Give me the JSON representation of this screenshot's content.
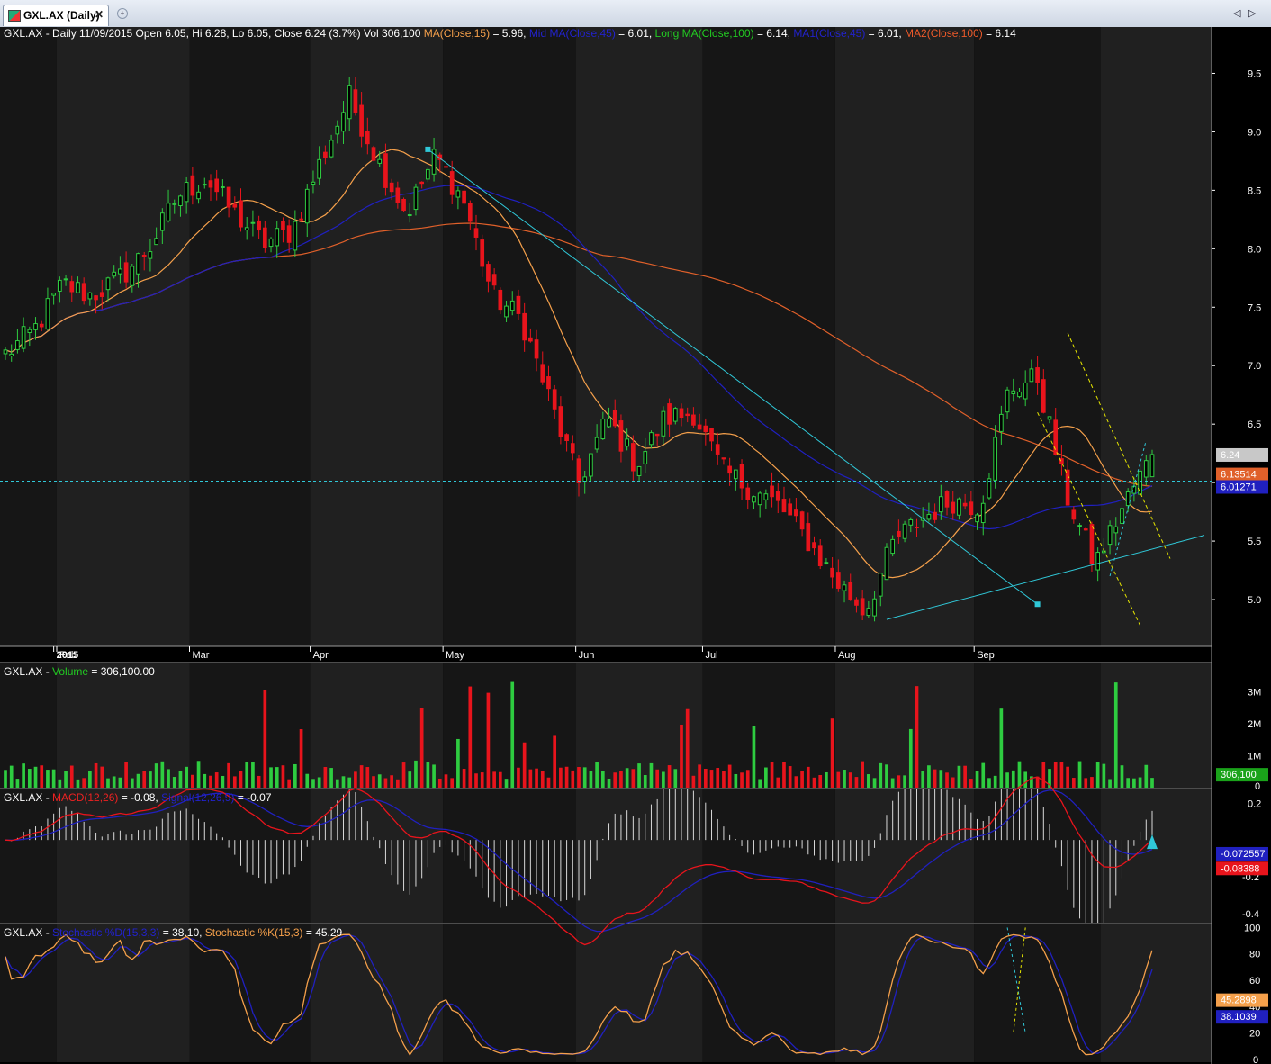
{
  "window": {
    "tab_title": "GXL.AX (Daily)",
    "close_glyph": "✕",
    "new_tab_glyph": "+",
    "nav_prev": "◁",
    "nav_next": "▷"
  },
  "panes": {
    "price": {
      "parts": [
        {
          "text": "GXL.AX - Daily 11/09/2015 Open 6.05, Hi 6.28, Lo 6.05, Close 6.24 (3.7%) Vol 306,100 ",
          "color": "#ffffff"
        },
        {
          "text": "MA(Close,15)",
          "color": "#f5a04b"
        },
        {
          "text": " = 5.96, ",
          "color": "#ffffff"
        },
        {
          "text": "Mid MA(Close,45)",
          "color": "#2222cc"
        },
        {
          "text": " = 6.01, ",
          "color": "#ffffff"
        },
        {
          "text": "Long MA(Close,100)",
          "color": "#22cc22"
        },
        {
          "text": " = 6.14, ",
          "color": "#ffffff"
        },
        {
          "text": "MA1(Close,45)",
          "color": "#2222cc"
        },
        {
          "text": " = 6.01, ",
          "color": "#ffffff"
        },
        {
          "text": "MA2(Close,100)",
          "color": "#ee5a2a"
        },
        {
          "text": " = 6.14",
          "color": "#ffffff"
        }
      ]
    },
    "volume": {
      "parts": [
        {
          "text": "GXL.AX - ",
          "color": "#ffffff"
        },
        {
          "text": "Volume",
          "color": "#22cc22"
        },
        {
          "text": " = 306,100.00",
          "color": "#ffffff"
        }
      ]
    },
    "macd": {
      "parts": [
        {
          "text": "GXL.AX - ",
          "color": "#ffffff"
        },
        {
          "text": "MACD(12,26)",
          "color": "#ee2222"
        },
        {
          "text": " = -0.08, ",
          "color": "#ffffff"
        },
        {
          "text": "Signal(12,26,9)",
          "color": "#2222cc"
        },
        {
          "text": " = -0.07",
          "color": "#ffffff"
        }
      ]
    },
    "stoch": {
      "parts": [
        {
          "text": "GXL.AX - ",
          "color": "#ffffff"
        },
        {
          "text": "Stochastic %D(15,3,3)",
          "color": "#2222cc"
        },
        {
          "text": " = 38.10, ",
          "color": "#ffffff"
        },
        {
          "text": "Stochastic %K(15,3)",
          "color": "#f5a04b"
        },
        {
          "text": " = 45.29",
          "color": "#ffffff"
        }
      ]
    }
  },
  "badges": {
    "price_close": "6.24",
    "price_ma100": "6.13514",
    "price_ma45": "6.01271",
    "volume": "306,100",
    "macd_signal": "-0.072557",
    "macd_value": "-0.08388",
    "stoch_k": "45.2898",
    "stoch_d": "38.1039"
  },
  "colors": {
    "up": "#2ecc40",
    "down": "#e8141c",
    "ma15": "#f5a04b",
    "ma45": "#2020c0",
    "ma100": "#e0602a",
    "trend": "#30c8d8",
    "channel": "#e6e600"
  },
  "chart_data": {
    "type": "candlestick",
    "symbol": "GXL.AX",
    "period": "Daily",
    "x_labels": [
      "2015",
      "Feb",
      "Mar",
      "Apr",
      "May",
      "Jun",
      "Jul",
      "Aug",
      "Sep"
    ],
    "y_ticks": [
      5.0,
      5.5,
      6.0,
      6.5,
      7.0,
      7.5,
      8.0,
      8.5,
      9.0,
      9.5
    ],
    "ylim": [
      4.6,
      9.85
    ],
    "first_date": "2014-12-19",
    "last_date": "2015-09-11",
    "close_anchors": [
      7.1,
      7.3,
      7.7,
      7.6,
      7.75,
      8.0,
      8.45,
      8.6,
      8.3,
      8.05,
      8.15,
      8.75,
      9.3,
      8.75,
      8.3,
      8.8,
      8.4,
      7.6,
      7.4,
      6.7,
      6.0,
      6.55,
      6.15,
      6.55,
      6.6,
      6.1,
      5.95,
      5.8,
      5.5,
      5.15,
      4.9,
      5.5,
      5.7,
      5.85,
      5.8,
      6.8,
      6.9,
      5.9,
      5.3,
      5.8,
      6.24
    ],
    "last_bar": {
      "date": "11/09/2015",
      "open": 6.05,
      "high": 6.28,
      "low": 6.05,
      "close": 6.24,
      "change_pct": "3.7%",
      "volume": 306100
    },
    "moving_averages": [
      {
        "name": "MA(Close,15)",
        "value": 5.96
      },
      {
        "name": "Mid MA(Close,45)",
        "value": 6.01
      },
      {
        "name": "Long MA(Close,100)",
        "value": 6.14
      },
      {
        "name": "MA1(Close,45)",
        "value": 6.01
      },
      {
        "name": "MA2(Close,100)",
        "value": 6.14
      }
    ],
    "horizontal_line": 6.0127,
    "volume": {
      "y_ticks": [
        "1M",
        "2M",
        "3M"
      ],
      "ylim": [
        0,
        3800000
      ],
      "last": 306100
    },
    "macd": {
      "y_ticks": [
        0.2,
        0.0,
        -0.2,
        -0.4
      ],
      "ylim": [
        -0.45,
        0.28
      ],
      "macd": -0.08,
      "signal": -0.07
    },
    "stochastic": {
      "y_ticks": [
        0,
        20,
        40,
        60,
        80,
        100
      ],
      "ylim": [
        -2,
        103
      ],
      "d": 38.1,
      "k": 45.29
    }
  }
}
